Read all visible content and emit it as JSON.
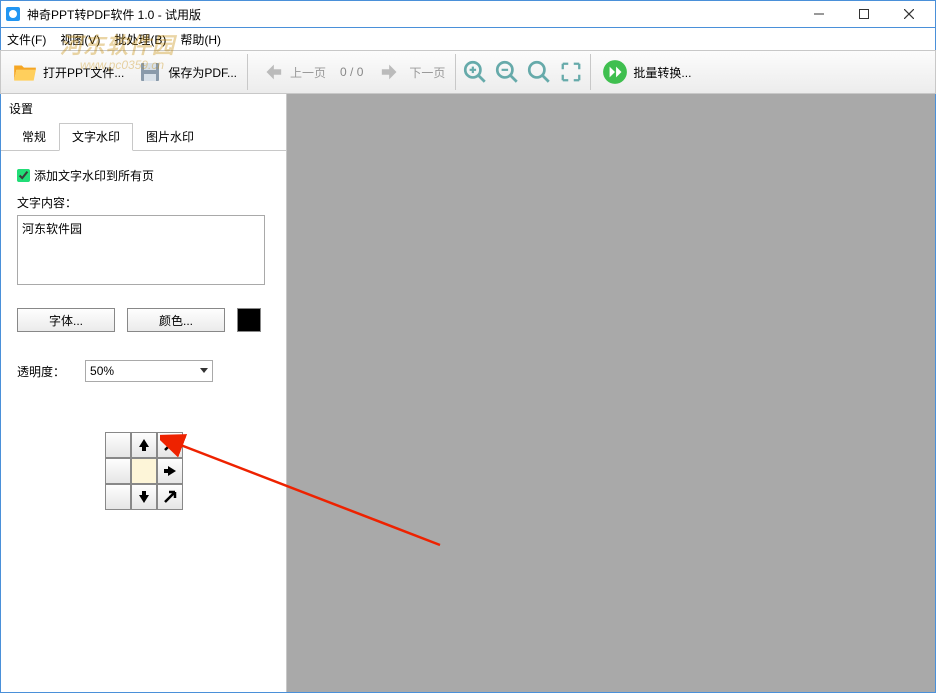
{
  "titlebar": {
    "title": "神奇PPT转PDF软件 1.0 - 试用版"
  },
  "menubar": {
    "file": "文件(F)",
    "view": "视图(V)",
    "batch": "批处理(B)",
    "help": "帮助(H)"
  },
  "toolbar": {
    "open_ppt": "打开PPT文件...",
    "save_pdf": "保存为PDF...",
    "prev_page": "上一页",
    "pager": "0 / 0",
    "next_page": "下一页",
    "batch_convert": "批量转换..."
  },
  "side": {
    "header": "设置",
    "tabs": {
      "general": "常规",
      "text_wm": "文字水印",
      "image_wm": "图片水印"
    },
    "text_wm": {
      "apply_all": "添加文字水印到所有页",
      "content_label": "文字内容：",
      "content_value": "河东软件园",
      "font_btn": "字体...",
      "color_btn": "颜色...",
      "color_value": "#000000",
      "opacity_label": "透明度：",
      "opacity_value": "50%"
    }
  },
  "overlay": {
    "site_brand": "河东软件园",
    "site_url": "www.pc0359.cn"
  }
}
